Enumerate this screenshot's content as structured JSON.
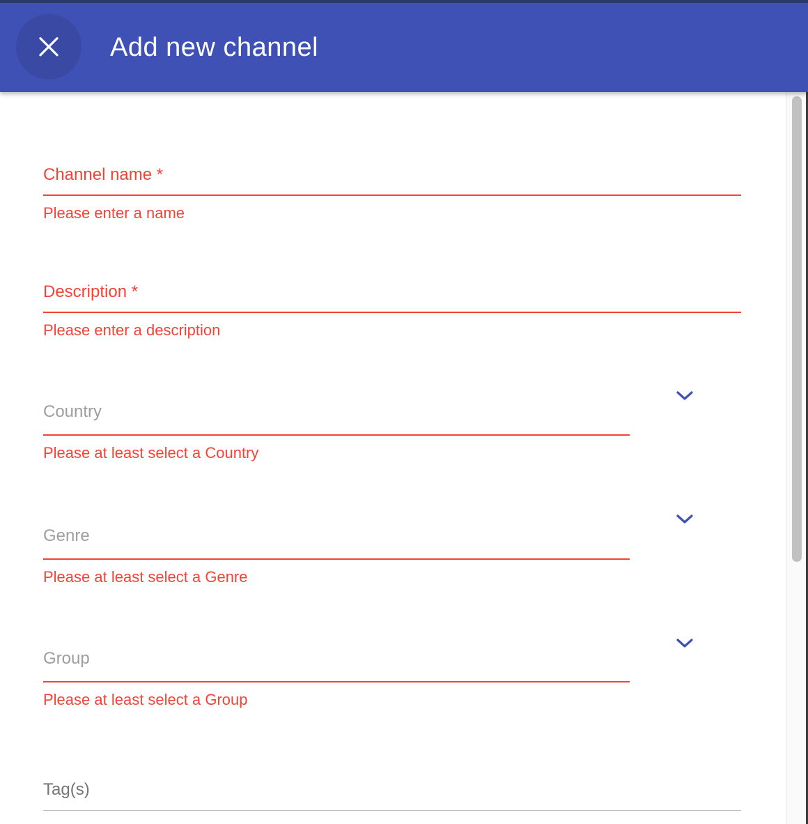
{
  "dialog": {
    "title": "Add new channel",
    "close_icon": "close-icon"
  },
  "form": {
    "channel_name": {
      "label": "Channel name *",
      "value": "",
      "error": "Please enter a name"
    },
    "description": {
      "label": "Description *",
      "value": "",
      "error": "Please enter a description"
    },
    "country": {
      "label": "Country",
      "value": "",
      "error": "Please at least select a Country",
      "icon": "chevron-down-icon"
    },
    "genre": {
      "label": "Genre",
      "value": "",
      "error": "Please at least select a Genre",
      "icon": "chevron-down-icon"
    },
    "group": {
      "label": "Group",
      "value": "",
      "error": "Please at least select a Group",
      "icon": "chevron-down-icon"
    },
    "tags": {
      "label": "Tag(s)",
      "value": ""
    }
  },
  "colors": {
    "app_bar": "#3f51b5",
    "error": "#f44336",
    "accent": "#3f51b5"
  }
}
